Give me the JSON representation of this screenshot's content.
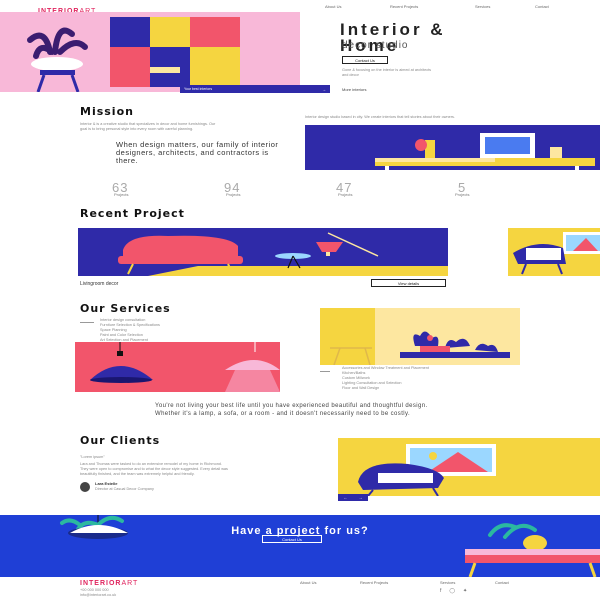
{
  "brand": {
    "strong": "INTERIOR",
    "light": "ART"
  },
  "nav": [
    "About Us",
    "Recent Projects",
    "Services",
    "Contact"
  ],
  "hero": {
    "title_line1": "Interior &",
    "title_line2": "Home",
    "subtitle": "decor studio",
    "button": "Contact Us",
    "text": "Gone & focusing on the interior is aimed at architects and decor",
    "more_link": "More interiors",
    "caption": "Your best interiors"
  },
  "mission": {
    "title": "Mission",
    "body": "Interior & is a creative studio that specializes in decor and home furnishings. Our goal is to bring personal style into every room with careful planning.",
    "quote": "When design matters, our family of interior designers, architects, and contractors is there.",
    "side_text": "Interior design studio based in city. We create interiors that tell stories about their owners."
  },
  "stats": [
    {
      "num": "63",
      "label": "Projects"
    },
    {
      "num": "94",
      "label": "Projects"
    },
    {
      "num": "47",
      "label": "Projects"
    },
    {
      "num": "5",
      "label": "Projects"
    }
  ],
  "recent": {
    "title": "Recent Project",
    "caption": "Livingroom decor",
    "button": "View details"
  },
  "services": {
    "title": "Our Services",
    "list_a": [
      "Interior design consultation",
      "Furniture Selection & Specifications",
      "Space Planning",
      "Paint and Color Selection",
      "Art Selection and Placement"
    ],
    "list_b": [
      "Accessories and Window Treatment and Placement",
      "Kitchen/Baths",
      "Custom Millwork",
      "Lighting Consultation and Selection",
      "Floor and Wall Design"
    ]
  },
  "quote_text": "You're not living your best life until you have experienced beautiful and thoughtful design. Whether it's a lamp, a sofa, or a room - and it doesn't necessarily need to be costly.",
  "clients": {
    "title": "Our Clients",
    "intro": "\"Lorem ipsum\"",
    "body": "Lara and Thomas were tasked to do an extensive remodel of my home in Richmond. They were open to compromise and to what the decor style suggested. Every detail was beautifully finished, and the team was extremely helpful and friendly.",
    "author": "Lara Estelle",
    "role": "Director at Casual Decor Company"
  },
  "cta": {
    "title": "Have a project for us?",
    "button": "Contact Us"
  },
  "footer": {
    "brand_strong": "INTERIOR",
    "brand_light": "ART",
    "phone": "+00 000 000 000",
    "email": "info@interiorart.co.uk",
    "links": [
      "About Us",
      "Recent Projects",
      "Services",
      "Contact"
    ]
  },
  "colors": {
    "pink": "#f8b8d8",
    "navy": "#2f2aa8",
    "yellow": "#f5d540",
    "coral": "#f2556b",
    "blue": "#1f3fd6",
    "peach": "#fde7a0"
  }
}
